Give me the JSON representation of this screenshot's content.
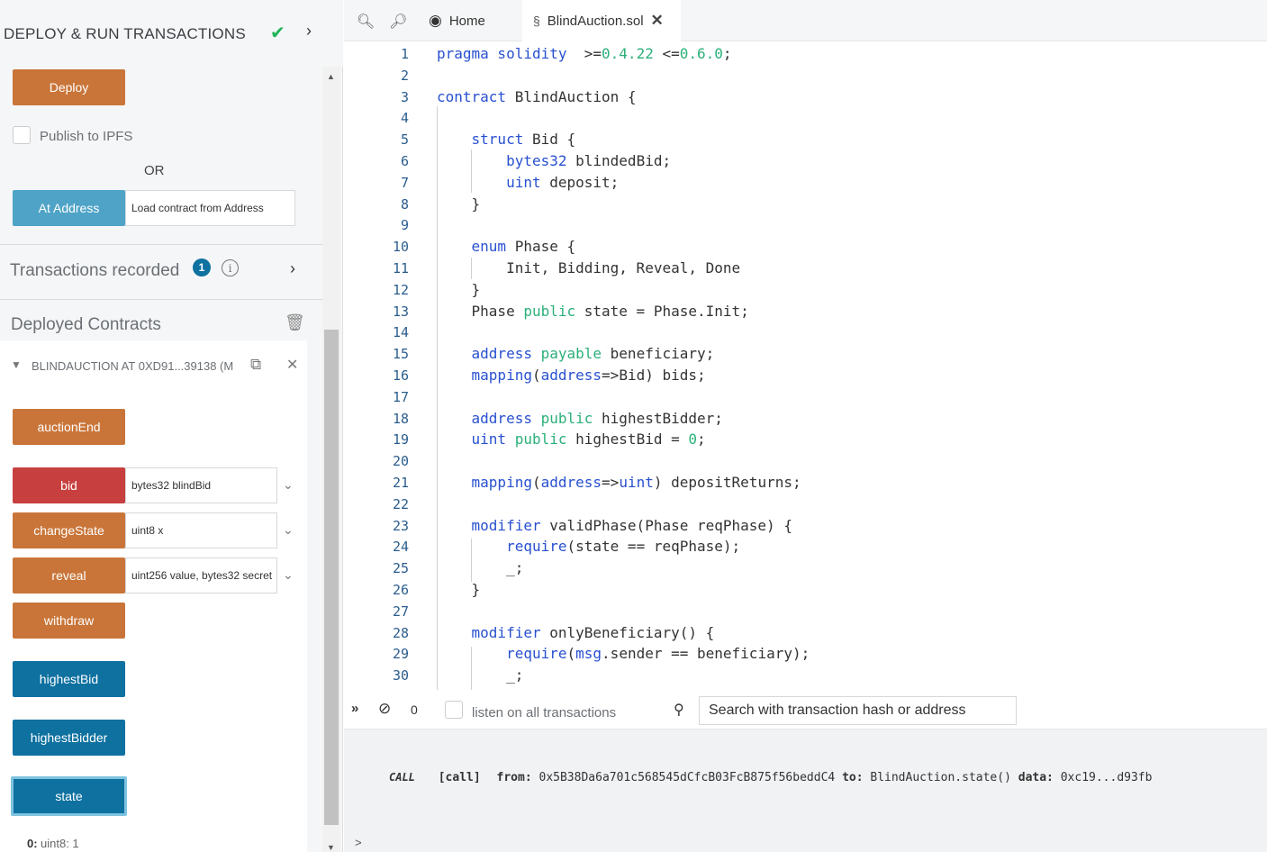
{
  "panel": {
    "title": "DEPLOY & RUN TRANSACTIONS",
    "deploy": "Deploy",
    "publish": "Publish to IPFS",
    "or": "OR",
    "at_address": "At Address",
    "load_placeholder": "Load contract from Address",
    "tx_recorded": "Transactions recorded",
    "tx_count": "1",
    "deployed": "Deployed Contracts",
    "instance": "BLINDAUCTION AT 0XD91...39138 (M",
    "functions": [
      {
        "label": "auctionEnd",
        "color": "orange"
      },
      {
        "label": "bid",
        "color": "red",
        "param": "bytes32 blindBid"
      },
      {
        "label": "changeState",
        "color": "orange",
        "param": "uint8 x"
      },
      {
        "label": "reveal",
        "color": "orange",
        "param": "uint256 value, bytes32 secret"
      },
      {
        "label": "withdraw",
        "color": "orange"
      },
      {
        "label": "highestBid",
        "color": "blue"
      },
      {
        "label": "highestBidder",
        "color": "blue"
      },
      {
        "label": "state",
        "color": "blue"
      }
    ],
    "result_key": "0:",
    "result_val": "uint8: 1"
  },
  "tabs": {
    "home": "Home",
    "file": "BlindAuction.sol"
  },
  "code": [
    [
      [
        "kw",
        "pragma solidity"
      ],
      [
        "",
        "  "
      ],
      [
        "",
        "&gt;="
      ],
      [
        "num",
        "0.4.22"
      ],
      [
        "",
        " &lt;="
      ],
      [
        "num",
        "0.6.0"
      ],
      [
        "",
        ";"
      ]
    ],
    [],
    [
      [
        "kw",
        "contract"
      ],
      [
        "",
        " BlindAuction {"
      ]
    ],
    [],
    [
      [
        "",
        "    "
      ],
      [
        "kw",
        "struct"
      ],
      [
        "",
        " Bid {"
      ]
    ],
    [
      [
        "",
        "        "
      ],
      [
        "kw",
        "bytes32"
      ],
      [
        "",
        " blindedBid;"
      ]
    ],
    [
      [
        "",
        "        "
      ],
      [
        "kw",
        "uint"
      ],
      [
        "",
        " deposit;"
      ]
    ],
    [
      [
        "",
        "    }"
      ]
    ],
    [],
    [
      [
        "",
        "    "
      ],
      [
        "kw",
        "enum"
      ],
      [
        "",
        " Phase {"
      ]
    ],
    [
      [
        "",
        "        Init, Bidding, Reveal, Done"
      ]
    ],
    [
      [
        "",
        "    }"
      ]
    ],
    [
      [
        "",
        "    Phase "
      ],
      [
        "kw2",
        "public"
      ],
      [
        "",
        " state = Phase.Init;"
      ]
    ],
    [],
    [
      [
        "",
        "    "
      ],
      [
        "kw",
        "address"
      ],
      [
        " kw2",
        " payable"
      ],
      [
        "",
        " beneficiary;"
      ]
    ],
    [
      [
        "",
        "    "
      ],
      [
        "kw",
        "mapping"
      ],
      [
        "",
        "("
      ],
      [
        "kw",
        "address"
      ],
      [
        "",
        "=&gt;Bid) bids;"
      ]
    ],
    [],
    [
      [
        "",
        "    "
      ],
      [
        "kw",
        "address"
      ],
      [
        " kw2",
        " public"
      ],
      [
        "",
        " highestBidder;"
      ]
    ],
    [
      [
        "",
        "    "
      ],
      [
        "kw",
        "uint"
      ],
      [
        " kw2",
        " public"
      ],
      [
        "",
        " highestBid = "
      ],
      [
        "num",
        "0"
      ],
      [
        "",
        ";"
      ]
    ],
    [],
    [
      [
        "",
        "    "
      ],
      [
        "kw",
        "mapping"
      ],
      [
        "",
        "("
      ],
      [
        "kw",
        "address"
      ],
      [
        "",
        "=&gt;"
      ],
      [
        "kw",
        "uint"
      ],
      [
        "",
        ") depositReturns;"
      ]
    ],
    [],
    [
      [
        "",
        "    "
      ],
      [
        "kw",
        "modifier"
      ],
      [
        "",
        " validPhase(Phase reqPhase) {"
      ]
    ],
    [
      [
        "",
        "        "
      ],
      [
        "kw",
        "require"
      ],
      [
        "",
        "(state == reqPhase);"
      ]
    ],
    [
      [
        "",
        "        _;"
      ]
    ],
    [
      [
        "",
        "    }"
      ]
    ],
    [],
    [
      [
        "",
        "    "
      ],
      [
        "kw",
        "modifier"
      ],
      [
        "",
        " onlyBeneficiary() {"
      ]
    ],
    [
      [
        "",
        "        "
      ],
      [
        "kw",
        "require"
      ],
      [
        "",
        "("
      ],
      [
        "kw",
        "msg"
      ],
      [
        "",
        ".sender == beneficiary);"
      ]
    ],
    [
      [
        "",
        "        _;"
      ]
    ]
  ],
  "terminal": {
    "count": "0",
    "listen": "listen on all transactions",
    "search_placeholder": "Search with transaction hash or address",
    "call_tag": "CALL",
    "call_kind": "[call]",
    "from_label": "from:",
    "from_val": "0x5B38Da6a701c568545dCfcB03FcB875f56beddC4",
    "to_label": "to:",
    "to_val": "BlindAuction.state()",
    "data_label": "data:",
    "data_val": "0xc19...d93fb",
    "prompt": ">"
  },
  "colors": {
    "orange": "#c97539",
    "red": "#c7403f",
    "blue": "#0e71a0",
    "teal": "#4fa3c7"
  }
}
